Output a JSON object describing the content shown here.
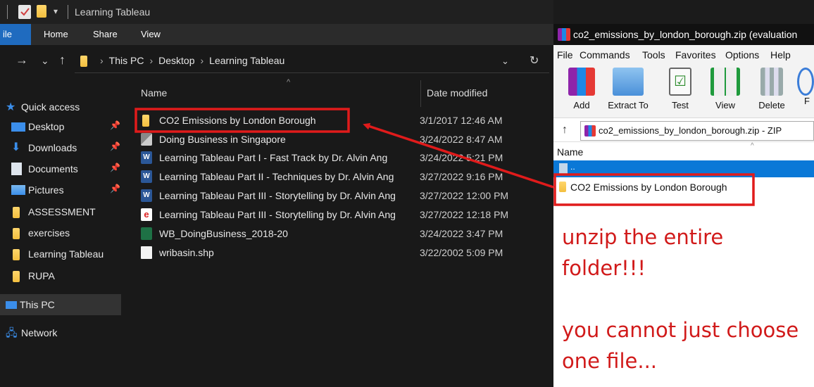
{
  "explorer": {
    "title": "Learning Tableau",
    "ribbon_tabs": [
      "ile",
      "Home",
      "Share",
      "View"
    ],
    "breadcrumb": [
      "This PC",
      "Desktop",
      "Learning Tableau"
    ],
    "nav": [
      {
        "label": "Quick access",
        "icon": "star-icon",
        "pinned": false
      },
      {
        "label": "Desktop",
        "icon": "desktop-icon",
        "pinned": true
      },
      {
        "label": "Downloads",
        "icon": "download-icon",
        "pinned": true
      },
      {
        "label": "Documents",
        "icon": "documents-icon",
        "pinned": true
      },
      {
        "label": "Pictures",
        "icon": "pictures-icon",
        "pinned": true
      },
      {
        "label": "ASSESSMENT",
        "icon": "folder-icon",
        "pinned": false
      },
      {
        "label": "exercises",
        "icon": "folder-icon",
        "pinned": false
      },
      {
        "label": "Learning Tableau",
        "icon": "folder-icon",
        "pinned": false
      },
      {
        "label": "RUPA",
        "icon": "folder-icon",
        "pinned": false
      },
      {
        "label": "This PC",
        "icon": "pc-icon",
        "pinned": false
      },
      {
        "label": "Network",
        "icon": "network-icon",
        "pinned": false
      }
    ],
    "columns": {
      "name": "Name",
      "date": "Date modified"
    },
    "files": [
      {
        "name": "CO2 Emissions by London Borough",
        "date": "3/1/2017 12:46 AM",
        "icon": "folder-icon"
      },
      {
        "name": "Doing Business in Singapore",
        "date": "3/24/2022 8:47 AM",
        "icon": "app-icon"
      },
      {
        "name": "Learning Tableau Part I - Fast Track by Dr. Alvin Ang",
        "date": "3/24/2022 5:21 PM",
        "icon": "word-icon"
      },
      {
        "name": "Learning Tableau Part II - Techniques by Dr. Alvin Ang",
        "date": "3/27/2022 9:16 PM",
        "icon": "word-icon"
      },
      {
        "name": "Learning Tableau Part III - Storytelling by Dr. Alvin Ang",
        "date": "3/27/2022 12:00 PM",
        "icon": "word-icon"
      },
      {
        "name": "Learning Tableau Part III - Storytelling by Dr. Alvin Ang",
        "date": "3/27/2022 12:18 PM",
        "icon": "pdf-icon"
      },
      {
        "name": "WB_DoingBusiness_2018-20",
        "date": "3/24/2022 3:47 PM",
        "icon": "excel-icon"
      },
      {
        "name": "wribasin.shp",
        "date": "3/22/2002 5:09 PM",
        "icon": "file-icon"
      }
    ]
  },
  "winrar": {
    "title": "co2_emissions_by_london_borough.zip (evaluation",
    "menu": [
      "File",
      "Commands",
      "Tools",
      "Favorites",
      "Options",
      "Help"
    ],
    "toolbar": [
      "Add",
      "Extract To",
      "Test",
      "View",
      "Delete",
      "F"
    ],
    "path": "co2_emissions_by_london_borough.zip - ZIP",
    "column_name": "Name",
    "parent_row": "..",
    "item": "CO2 Emissions by London Borough"
  },
  "note": {
    "line1": "unzip the entire",
    "line2": "folder!!!",
    "line3": "you cannot just choose",
    "line4": "one file..."
  },
  "colors": {
    "annotation": "#e01b1b",
    "selection": "#0a78d7",
    "file_tab": "#1f6bbf"
  }
}
